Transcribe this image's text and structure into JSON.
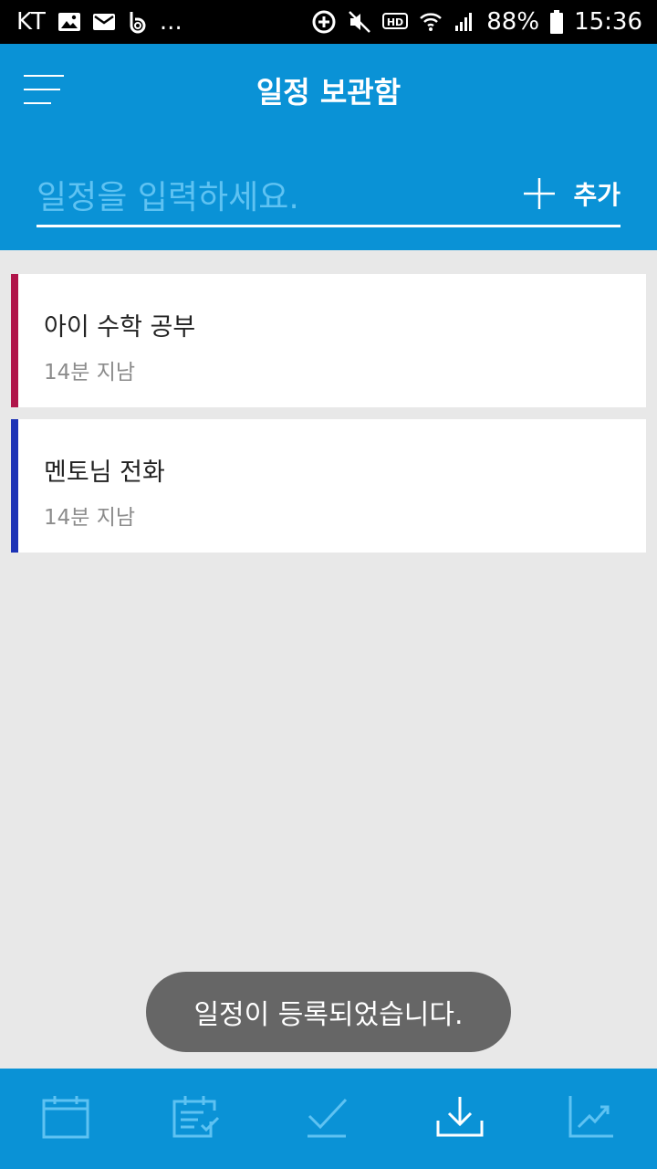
{
  "status_bar": {
    "carrier": "KT",
    "more": "...",
    "battery": "88%",
    "time": "15:36"
  },
  "appbar": {
    "title": "일정 보관함",
    "input_placeholder": "일정을 입력하세요.",
    "add_label": "추가"
  },
  "schedules": [
    {
      "title": "아이 수학 공부",
      "time": "14분 지남",
      "color": "#b0154a"
    },
    {
      "title": "멘토님 전화",
      "time": "14분 지남",
      "color": "#1d33b6"
    }
  ],
  "toast": {
    "message": "일정이 등록되었습니다."
  },
  "bottom_nav": {
    "items": [
      {
        "icon": "calendar-icon",
        "active": false
      },
      {
        "icon": "checklist-icon",
        "active": false
      },
      {
        "icon": "checkmark-icon",
        "active": false
      },
      {
        "icon": "download-icon",
        "active": true
      },
      {
        "icon": "chart-icon",
        "active": false
      }
    ]
  },
  "colors": {
    "primary": "#0a92d6",
    "inactive_icon": "#5ec2f2",
    "active_icon": "#ffffff"
  }
}
